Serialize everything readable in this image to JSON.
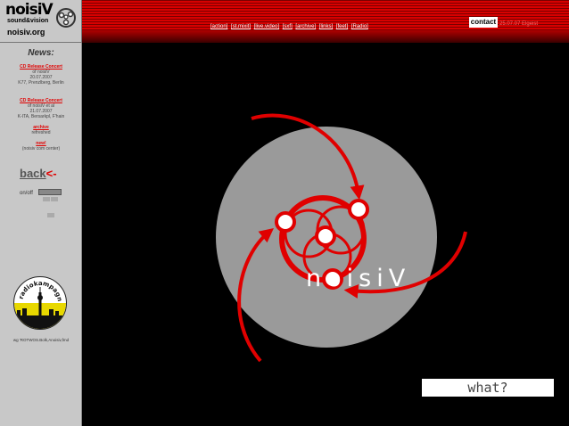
{
  "logo": {
    "title": "noisiV",
    "subtitle": "sound&vision",
    "url": "noisiv.org"
  },
  "nav": {
    "items": [
      "[action]",
      "[st.mixit]",
      "[live.video]",
      "[sxf]",
      "[archive]",
      "[links]",
      "[feet]",
      "[Radio]"
    ]
  },
  "contact": {
    "label": "contact",
    "date": "25.07.07 Elgeist"
  },
  "sidebar": {
    "news_title": "News:",
    "news": [
      {
        "headline": "CD Release Concert",
        "lines": [
          "of noisiV",
          "20.07.2007",
          "K77, Prenzlberg, Berlin"
        ]
      },
      {
        "headline": "CD Release Concert",
        "lines": [
          "of noisiV et al",
          "21.07.2007",
          "K-ITA, Bersarkpl, F'hain"
        ]
      },
      {
        "headline": "archive",
        "lines": [
          "refreshed"
        ]
      },
      {
        "headline": "new!",
        "lines": [
          "(noisiv com center)"
        ]
      }
    ],
    "back_label": "back",
    "back_arrow": "<-",
    "onoff_label": "on/off",
    "badge_text": "radiokampagne.de",
    "footer": "wg 'ROTWOS.Bolk,Anoisiv,fmd"
  },
  "main": {
    "logo_text": "noisiV",
    "what_label": "what?"
  },
  "colors": {
    "brand_red": "#e00000",
    "panel_gray": "#c8c8c8",
    "disc_gray": "#9a9a9a"
  }
}
